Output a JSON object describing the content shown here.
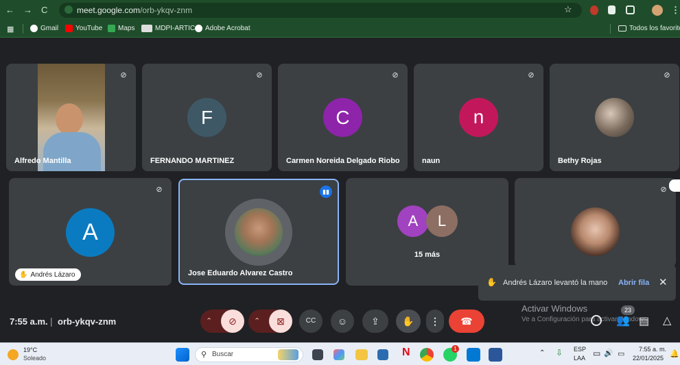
{
  "browser": {
    "url_host": "meet.google.com",
    "url_path": "/orb-ykqv-znm",
    "bookmarks": [
      {
        "label": "Gmail",
        "icon": "google-icon",
        "color": "#ffffff"
      },
      {
        "label": "YouTube",
        "icon": "youtube-icon",
        "color": "#ff0000"
      },
      {
        "label": "Maps",
        "icon": "maps-icon",
        "color": "#34a853"
      },
      {
        "label": "MDPI-ARTIC",
        "icon": "mdpi-icon",
        "color": "#dddddd"
      },
      {
        "label": "Adobe Acrobat",
        "icon": "acrobat-icon",
        "color": "#ffffff"
      }
    ],
    "all_bookmarks": "Todos los favoritos"
  },
  "tiles": {
    "alfredo": {
      "name": "Alfredo Mantilla"
    },
    "fernando": {
      "name": "FERNANDO MARTINEZ",
      "initial": "F",
      "color": "#3f5866"
    },
    "carmen": {
      "name": "Carmen Noreida Delgado Riobo",
      "initial": "C",
      "color": "#8e24aa"
    },
    "naun": {
      "name": "naun",
      "initial": "n",
      "color": "#c2185b"
    },
    "bethy": {
      "name": "Bethy Rojas"
    },
    "andres": {
      "name": "Andrés Lázaro",
      "initial": "A",
      "color": "#0b7bc1"
    },
    "jose": {
      "name": "Jose Eduardo Alvarez Castro"
    },
    "more": {
      "label": "15 más",
      "initial_a": "A",
      "initial_b": "L",
      "color_a": "#a142c0",
      "color_b": "#8d6e63"
    }
  },
  "bottom_bar": {
    "time": "7:55 a.m.",
    "separator": "|",
    "code": "orb-ykqv-znm",
    "people_count": "23"
  },
  "notification": {
    "text": "Andrés Lázaro levantó la mano",
    "action": "Abrir fila"
  },
  "watermark": {
    "title": "Activar Windows",
    "subtitle": "Ve a Configuración para activar Windows."
  },
  "taskbar": {
    "weather_temp": "19°C",
    "weather_text": "Soleado",
    "search_placeholder": "Buscar",
    "lang": "ESP",
    "lang_sub": "LAA",
    "clock_time": "7:55 a. m.",
    "clock_date": "22/01/2025",
    "whatsapp_badge": "1"
  }
}
